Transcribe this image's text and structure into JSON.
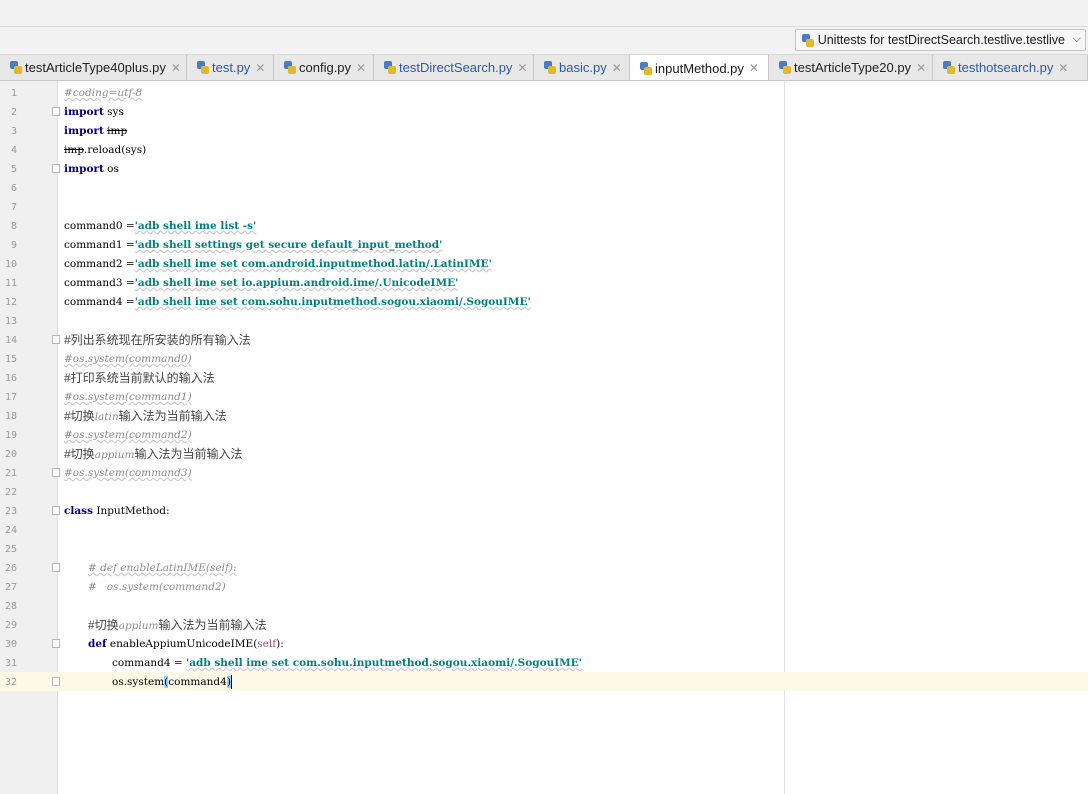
{
  "run_config": {
    "label": "Unittests for testDirectSearch.testlive.testlive"
  },
  "tabs": [
    {
      "label": "testArticleType40plus.py",
      "style": "normal"
    },
    {
      "label": "test.py",
      "style": "blue"
    },
    {
      "label": "config.py",
      "style": "normal"
    },
    {
      "label": "testDirectSearch.py",
      "style": "blue"
    },
    {
      "label": "basic.py",
      "style": "blue"
    },
    {
      "label": "inputMethod.py",
      "style": "active"
    },
    {
      "label": "testArticleType20.py",
      "style": "normal"
    },
    {
      "label": "testhotsearch.py",
      "style": "blue"
    }
  ],
  "code": {
    "line_numbers": [
      "1",
      "2",
      "3",
      "4",
      "5",
      "6",
      "7",
      "8",
      "9",
      "10",
      "11",
      "12",
      "13",
      "14",
      "15",
      "16",
      "17",
      "18",
      "19",
      "20",
      "21",
      "22",
      "23",
      "24",
      "25",
      "26",
      "27",
      "28",
      "29",
      "30",
      "31",
      "32"
    ],
    "l1": "#coding=utf-8",
    "l2_kw": "import",
    "l2_rest": " sys",
    "l3_kw": "import",
    "l3_mod": "imp",
    "l4_mod": "imp",
    "l4_rest": ".reload(sys)",
    "l5_kw": "import",
    "l5_rest": " os",
    "l8_var": "command0 =",
    "l8_str": "'adb shell ime list -s'",
    "l9_var": "command1 =",
    "l9_str": "'adb shell settings get secure default_input_method'",
    "l10_var": "command2 =",
    "l10_str": "'adb shell ime set com.android.inputmethod.latin/.LatinIME'",
    "l11_var": "command3 =",
    "l11_str": "'adb shell ime set io.appium.android.ime/.UnicodeIME'",
    "l12_var": "command4 =",
    "l12_str": "'adb shell ime set com.sohu.inputmethod.sogou.xiaomi/.SogouIME'",
    "l14_cmt": "#列出系统现在所安装的所有输入法",
    "l15_cmt": "#os.system(command0)",
    "l16_cmt": "#打印系统当前默认的输入法",
    "l17_cmt": "#os.system(command1)",
    "l18_a": "#切换",
    "l18_b": "latin",
    "l18_c": "输入法为当前输入法",
    "l19_cmt": "#os.system(command2)",
    "l20_a": "#切换",
    "l20_b": "appium",
    "l20_c": "输入法为当前输入法",
    "l21_cmt": "#os.system(command3)",
    "l23_kw": "class",
    "l23_rest": " InputMethod:",
    "l26_cmt": "# def enableLatinIME(self):",
    "l27_cmt": "#   os.system(command2)",
    "l29_a": "#切换",
    "l29_b": "appium",
    "l29_c": "输入法为当前输入法",
    "l30_kw": "def",
    "l30_name": " enableAppiumUnicodeIME(",
    "l30_self": "self",
    "l30_end": "):",
    "l31_var": "command4 = ",
    "l31_str": "'adb shell ime set com.sohu.inputmethod.sogou.xiaomi/.SogouIME'",
    "l32_a": "os.system",
    "l32_b": "(",
    "l32_c": "command4",
    "l32_d": ")"
  }
}
